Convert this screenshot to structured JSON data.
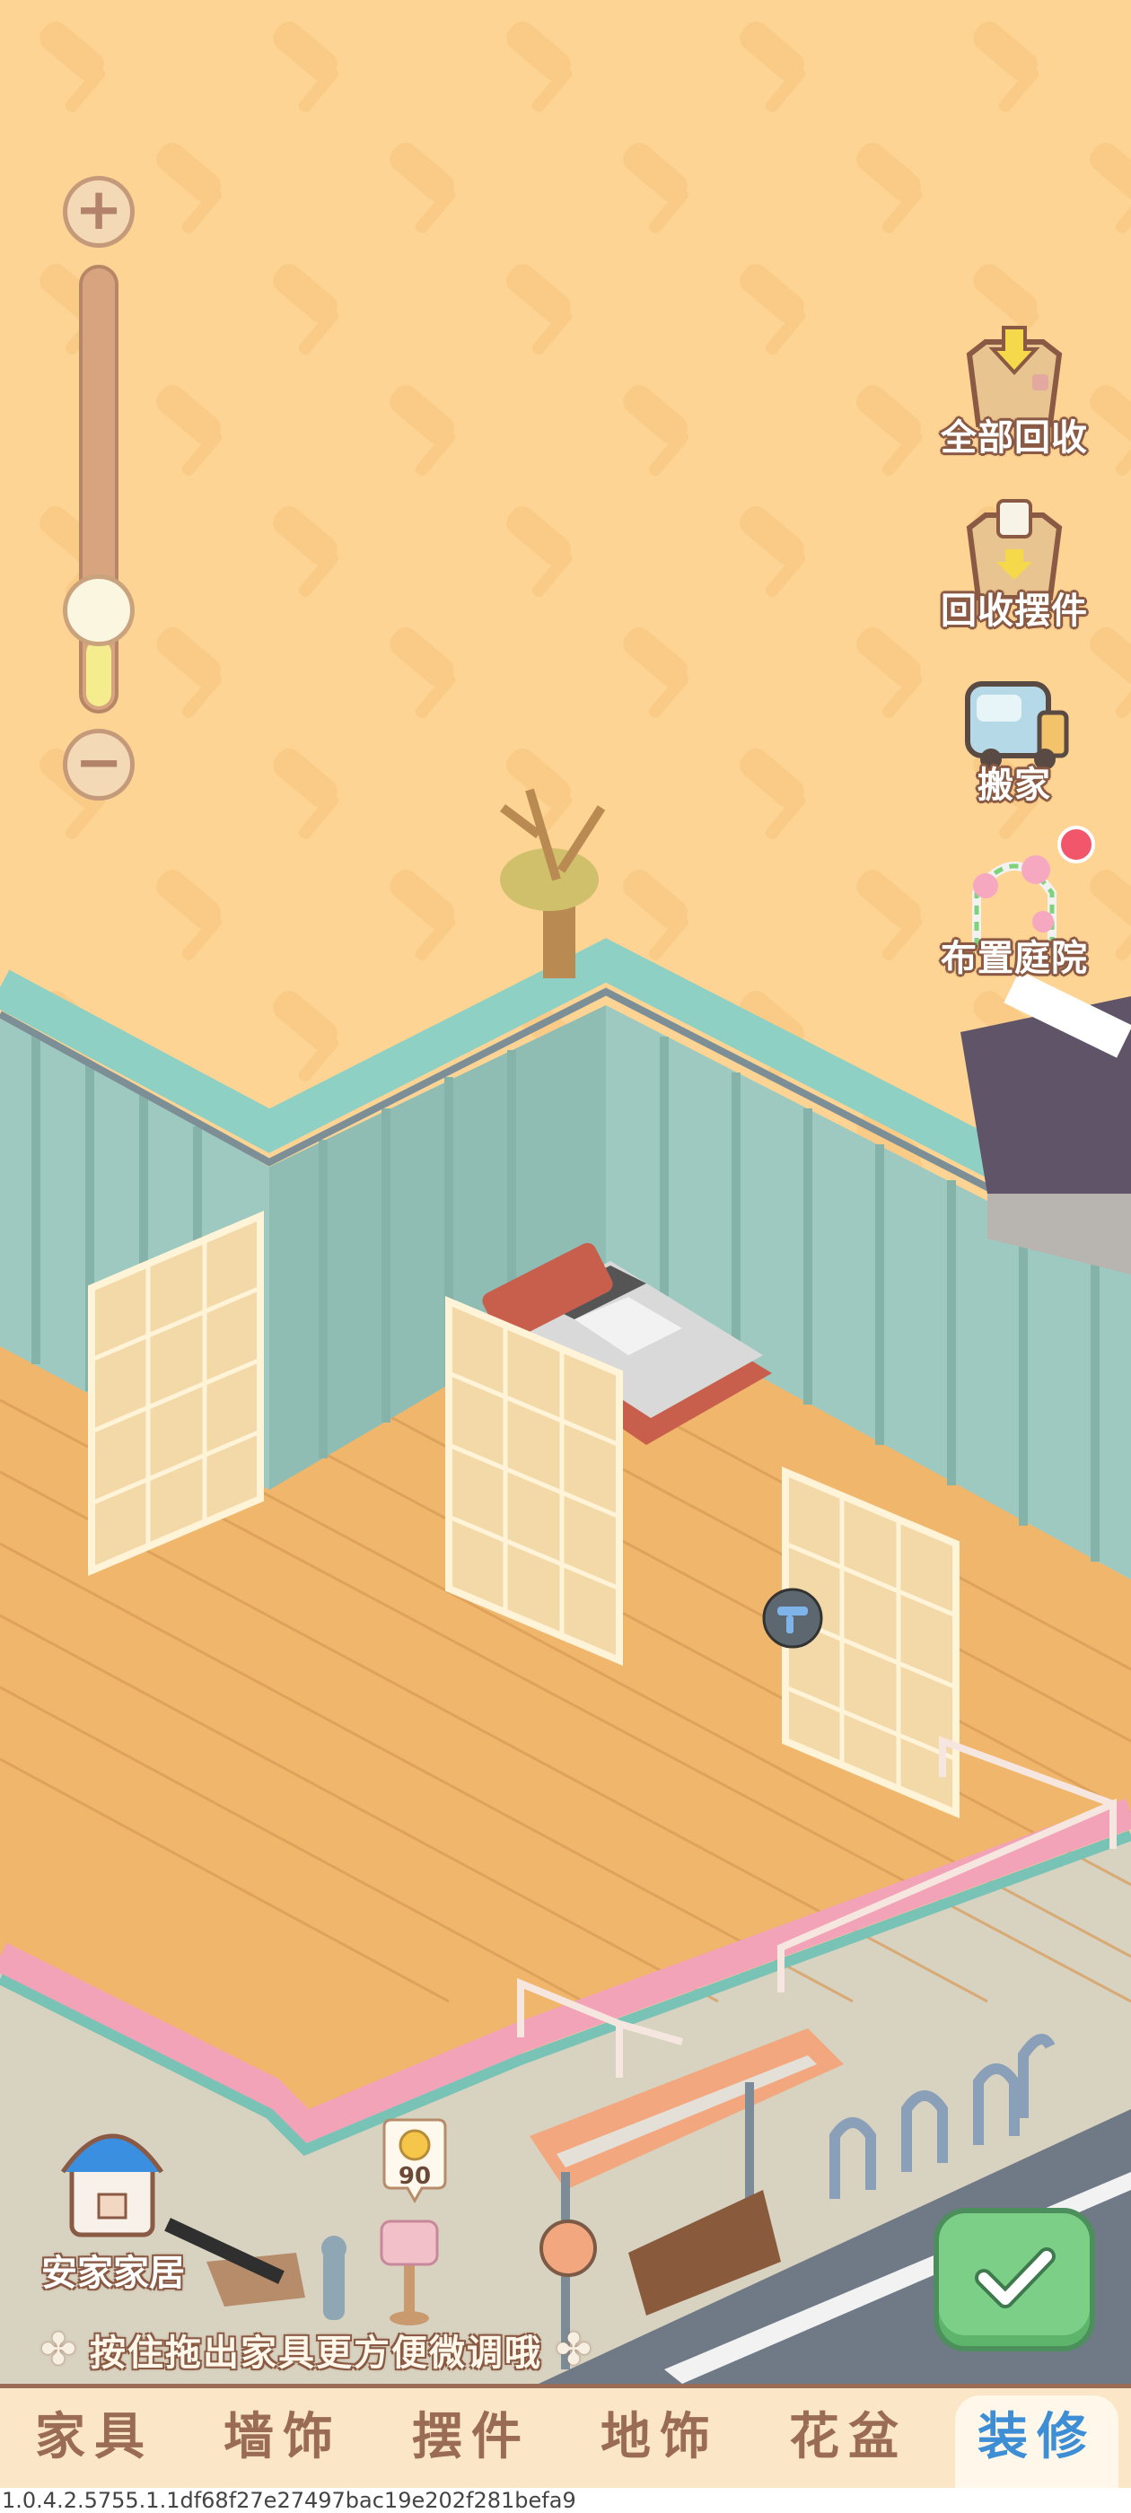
{
  "zoom": {
    "plus_label": "+",
    "minus_label": "−",
    "level": 0.15
  },
  "side_actions": [
    {
      "label": "全部回收",
      "icon": "box-recycle-all-icon"
    },
    {
      "label": "回收摆件",
      "icon": "box-recycle-ornament-icon"
    },
    {
      "label": "搬家",
      "icon": "moving-truck-icon"
    },
    {
      "label": "布置庭院",
      "icon": "garden-arch-icon",
      "notification": true
    }
  ],
  "home": {
    "label": "安家家居",
    "icon": "home-house-icon"
  },
  "mailbox": {
    "coin_value": "90"
  },
  "hint": {
    "text": "按住拖出家具更方便微调哦"
  },
  "tabs": [
    {
      "label": "家具",
      "active": false
    },
    {
      "label": "墙饰",
      "active": false
    },
    {
      "label": "摆件",
      "active": false
    },
    {
      "label": "地饰",
      "active": false
    },
    {
      "label": "花盆",
      "active": false
    },
    {
      "label": "装修",
      "active": true
    }
  ],
  "version": "1.0.4.2.5755.1.1df68f27e27497bac19e202f281befa9",
  "colors": {
    "background": "#fdd493",
    "wall": "#9ec9c0",
    "floor": "#f0b66b",
    "accent": "#3d8ed4",
    "confirm": "#7ccf87"
  }
}
